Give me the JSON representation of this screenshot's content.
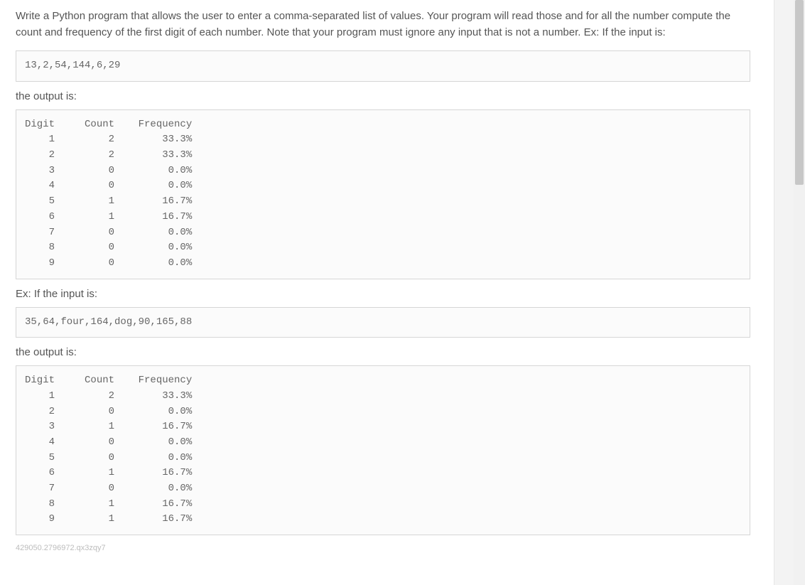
{
  "intro": "Write a Python program that allows the user to enter a comma-separated list of values. Your program will read those and for all the number compute the count and frequency of the first digit of each number. Note that your program must ignore any input that is not a number. Ex: If the input is:",
  "example1": {
    "input": "13,2,54,144,6,29",
    "output_label": "the output is:",
    "output": "Digit     Count    Frequency\n    1         2        33.3%\n    2         2        33.3%\n    3         0         0.0%\n    4         0         0.0%\n    5         1        16.7%\n    6         1        16.7%\n    7         0         0.0%\n    8         0         0.0%\n    9         0         0.0%"
  },
  "example2": {
    "prompt_label": "Ex: If the input is:",
    "input": "35,64,four,164,dog,90,165,88",
    "output_label": "the output is:",
    "output": "Digit     Count    Frequency\n    1         2        33.3%\n    2         0         0.0%\n    3         1        16.7%\n    4         0         0.0%\n    5         0         0.0%\n    6         1        16.7%\n    7         0         0.0%\n    8         1        16.7%\n    9         1        16.7%"
  },
  "footer_id": "429050.2796972.qx3zqy7"
}
